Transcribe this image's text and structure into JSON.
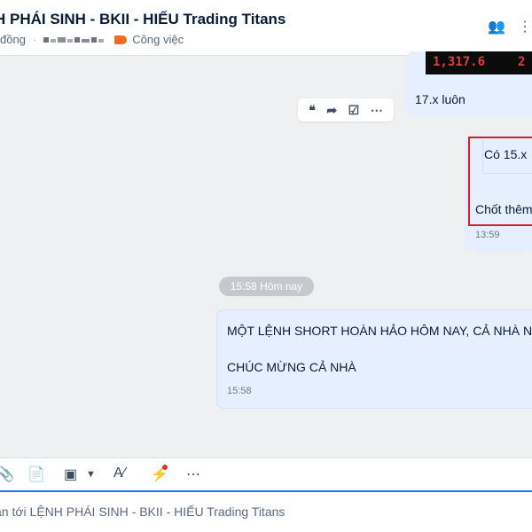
{
  "header": {
    "title": "H PHÁI SINH - BKII - HIẾU Trading Titans",
    "status": "đồng",
    "separator": "·",
    "tag_label": "Công việc",
    "icons": [
      "add-member-icon",
      "more-icon"
    ]
  },
  "messages": [
    {
      "image_values": [
        "1,317.6",
        "2"
      ],
      "text": "17.x luôn"
    },
    {
      "lines": [
        "Có 15.x",
        "Chốt thêm"
      ],
      "time": "13:59"
    },
    {
      "line1": "MỘT LỆNH SHORT HOÀN HẢO HÔM NAY, CẢ NHÀ NGH",
      "line2": "CHÚC MỪNG CẢ NHÀ",
      "time": "15:58"
    }
  ],
  "day_separator": "15:58 Hôm nay",
  "message_actions": [
    "quote-icon",
    "forward-icon",
    "todo-icon",
    "more-icon"
  ],
  "toolbar_icons": [
    "attach-icon",
    "contact-card-icon",
    "screenshot-icon",
    "dropdown-icon",
    "text-format-icon",
    "quick-message-icon",
    "more-icon"
  ],
  "composer": {
    "placeholder": "ắn tới LỆNH PHÁI SINH - BKII - HIẾU Trading Titans"
  },
  "colors": {
    "accent": "#1b74e4",
    "bubble": "#e5efff",
    "highlight": "#d5202a",
    "tag": "#f26b21"
  }
}
